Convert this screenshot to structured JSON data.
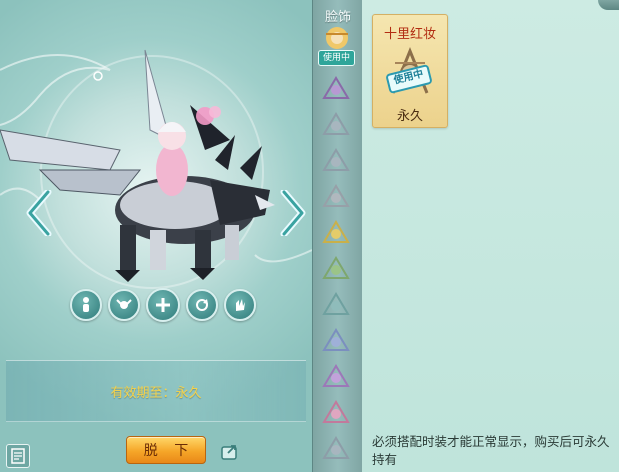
{
  "preview": {
    "expiry_text": "有效期至：永久",
    "take_off_label": "脱 下"
  },
  "category": {
    "title": "脸饰",
    "active_badge": "使用中",
    "thumbs": [
      "purple",
      "grey",
      "grey",
      "grey",
      "yellow",
      "green",
      "teal",
      "blue",
      "violet",
      "pink",
      "grey"
    ]
  },
  "item": {
    "name": "十里红妆",
    "status_badge": "使用中",
    "duration": "永久"
  },
  "footer": {
    "notice": "必须搭配时装才能正常显示，购买后可永久持有"
  },
  "colors": {
    "accent_gold": "#f6d34a",
    "button_orange": "#f5a628",
    "item_name_red": "#b22d12",
    "badge_teal": "#2fa59a"
  }
}
